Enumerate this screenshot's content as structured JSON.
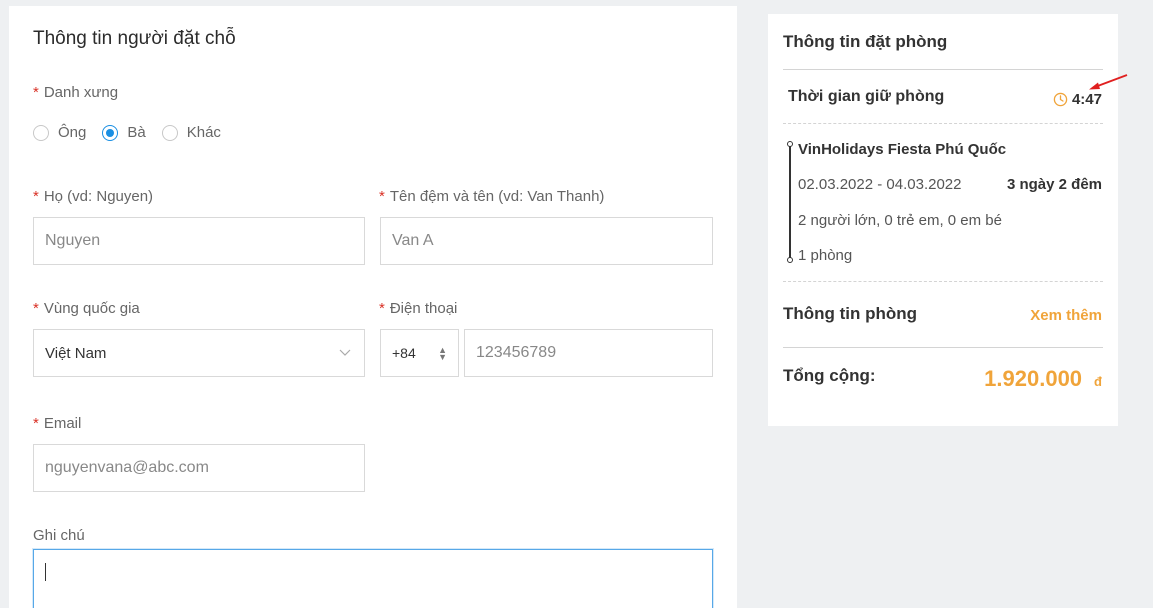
{
  "form": {
    "title": "Thông tin người đặt chỗ",
    "required_mark": "*",
    "salutation": {
      "label": "Danh xưng",
      "options": [
        "Ông",
        "Bà",
        "Khác"
      ],
      "selected": "Bà"
    },
    "last_name": {
      "label": "Họ (vd: Nguyen)",
      "value": "Nguyen"
    },
    "first_name": {
      "label": "Tên đệm và tên (vd: Van Thanh)",
      "value": "Van A"
    },
    "country": {
      "label": "Vùng quốc gia",
      "value": "Việt Nam"
    },
    "phone": {
      "label": "Điện thoại",
      "code": "+84",
      "number": "123456789"
    },
    "email": {
      "label": "Email",
      "value": "nguyenvana@abc.com"
    },
    "note": {
      "label": "Ghi chú",
      "value": ""
    }
  },
  "summary": {
    "title": "Thông tin đặt phòng",
    "hold_label": "Thời gian giữ phòng",
    "hold_time": "4:47",
    "hotel_name": "VinHolidays Fiesta Phú Quốc",
    "dates": "02.03.2022 - 04.03.2022",
    "duration": "3 ngày 2 đêm",
    "guests": "2 người lớn, 0 trẻ em, 0 em bé",
    "rooms": "1 phòng",
    "room_info_label": "Thông tin phòng",
    "see_more": "Xem thêm",
    "total_label": "Tổng cộng:",
    "total_value": "1.920.000",
    "currency": "đ"
  },
  "colors": {
    "accent": "#f0a43a",
    "radio_selected": "#1a8fe3",
    "required": "#d93025",
    "annotation_arrow": "#e02020"
  }
}
